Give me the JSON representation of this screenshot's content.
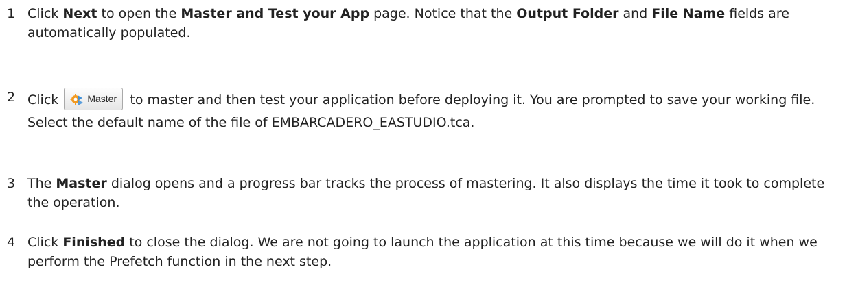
{
  "steps": [
    {
      "number": "1",
      "segments": [
        {
          "text": "Click "
        },
        {
          "text": "Next",
          "bold": true
        },
        {
          "text": " to open the "
        },
        {
          "text": "Master and Test your App",
          "bold": true
        },
        {
          "text": " page. Notice that the "
        },
        {
          "text": "Output Folder",
          "bold": true
        },
        {
          "text": " and "
        },
        {
          "text": "File Name",
          "bold": true
        },
        {
          "text": " fields are automatically populated."
        }
      ]
    },
    {
      "number": "2",
      "before_button": "Click ",
      "button": {
        "label": "Master",
        "icon": "master-icon",
        "icon_colors": {
          "orange": "#f29a21",
          "blue": "#3f8fd8"
        }
      },
      "after_button": " to master and then test your application before deploying it. You are prompted to save your working file. Select the default name of the file of EMBARCADERO_EASTUDIO.tca."
    },
    {
      "number": "3",
      "segments": [
        {
          "text": "The "
        },
        {
          "text": "Master",
          "bold": true
        },
        {
          "text": " dialog opens and a progress bar tracks the process of mastering. It also displays the time it took to complete the operation."
        }
      ]
    },
    {
      "number": "4",
      "segments": [
        {
          "text": "Click "
        },
        {
          "text": "Finished",
          "bold": true
        },
        {
          "text": " to close the dialog. We are not going to launch the application at this time because we will do it when we perform the Prefetch function in the next step."
        }
      ]
    }
  ]
}
